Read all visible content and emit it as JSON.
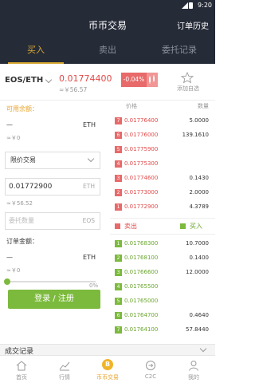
{
  "status_bar": {
    "time": "9:20"
  },
  "header": {
    "title": "币币交易",
    "history_label": "订单历史"
  },
  "tabs": [
    {
      "label": "买入",
      "active": true
    },
    {
      "label": "卖出",
      "active": false
    },
    {
      "label": "委托记录",
      "active": false
    }
  ],
  "pair": {
    "symbol": "EOS/ETH",
    "last_price": "0.01774400",
    "last_price_cny": "≈￥56.57",
    "change": "-0.04%",
    "favorite_label": "添加自选"
  },
  "order_form": {
    "available_label": "可用余额：",
    "available_value": "—",
    "available_currency": "ETH",
    "available_cny": "≈￥0",
    "order_type": "限价交易",
    "price_value": "0.01772900",
    "price_currency": "ETH",
    "price_cny": "≈￥56.52",
    "amount_placeholder": "委托数量",
    "amount_currency": "EOS",
    "total_label": "订单金额：",
    "total_value": "—",
    "total_currency": "ETH",
    "total_cny": "≈￥0",
    "slider_percent": "0%",
    "slider_fraction": 0,
    "submit_label": "登录 / 注册"
  },
  "order_book": {
    "price_header": "价格",
    "amount_header": "数量",
    "asks": [
      {
        "idx": "7",
        "price": "0.01776400",
        "amount": "5.0000"
      },
      {
        "idx": "6",
        "price": "0.01776000",
        "amount": "139.1610"
      },
      {
        "idx": "5",
        "price": "0.01775900",
        "amount": ""
      },
      {
        "idx": "4",
        "price": "0.01775300",
        "amount": ""
      },
      {
        "idx": "3",
        "price": "0.01774600",
        "amount": "0.1430"
      },
      {
        "idx": "2",
        "price": "0.01773000",
        "amount": "2.0000"
      },
      {
        "idx": "1",
        "price": "0.01772900",
        "amount": "4.3789"
      }
    ],
    "sell_label": "卖出",
    "buy_label": "买入",
    "bids": [
      {
        "idx": "1",
        "price": "0.01768300",
        "amount": "10.7000"
      },
      {
        "idx": "2",
        "price": "0.01768100",
        "amount": "0.1400"
      },
      {
        "idx": "3",
        "price": "0.01766600",
        "amount": "12.0000"
      },
      {
        "idx": "4",
        "price": "0.01765500",
        "amount": ""
      },
      {
        "idx": "5",
        "price": "0.01765000",
        "amount": ""
      },
      {
        "idx": "6",
        "price": "0.01764700",
        "amount": "0.4640"
      },
      {
        "idx": "7",
        "price": "0.01764100",
        "amount": "57.8440"
      }
    ]
  },
  "records": {
    "label": "成交记录"
  },
  "bottom_nav": [
    {
      "label": "首页",
      "icon": "home-icon",
      "active": false
    },
    {
      "label": "行情",
      "icon": "chart-icon",
      "active": false
    },
    {
      "label": "币币交易",
      "icon": "coin-icon",
      "active": true
    },
    {
      "label": "C2C",
      "icon": "c2c-icon",
      "active": false
    },
    {
      "label": "我的",
      "icon": "user-icon",
      "active": false
    }
  ],
  "colors": {
    "header_bg": "#262b38",
    "accent_gold": "#d6a833",
    "sell_red": "#e86a6a",
    "buy_green": "#7cba3d"
  }
}
